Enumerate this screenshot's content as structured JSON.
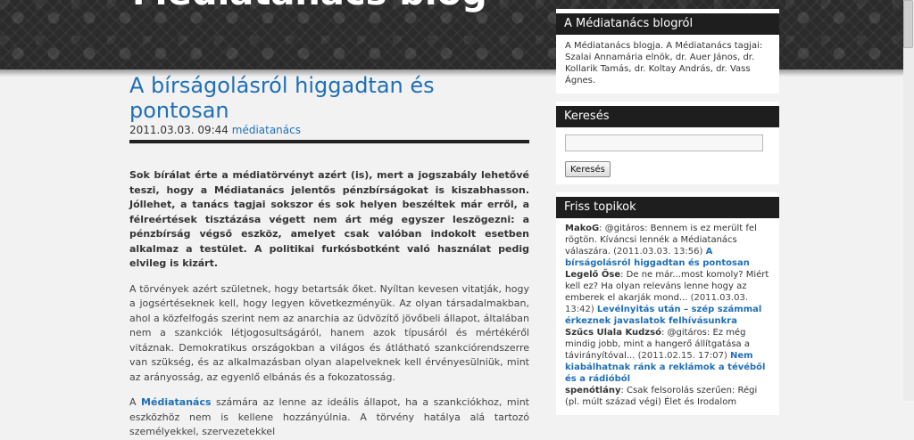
{
  "header": {
    "blog_title": "Médiatanács blog"
  },
  "post": {
    "title": "A bírságolásról higgadtan és pontosan",
    "date": "2011.03.03. 09:44",
    "author": "médiatanács",
    "lead": "Sok bírálat érte a médiatörvényt azért (is), mert a jogszabály lehetővé teszi, hogy a Médiatanács jelentős pénzbírságokat is kiszabhasson. Jóllehet, a tanács tagjai sokszor és sok helyen beszéltek már erről, a félreértések tisztázása végett nem árt még egyszer leszögezni: a pénzbírság végső eszköz, amelyet csak valóban indokolt esetben alkalmaz a testület. A politikai furkósbotként való használat pedig elvileg is kizárt.",
    "paragraph1": "A törvények azért születnek, hogy betartsák őket. Nyíltan kevesen vitatják, hogy a jogsértéseknek kell, hogy legyen következményük. Az olyan társadalmakban, ahol a közfelfogás szerint nem az anarchia az üdvözítő jövőbeli állapot, általában nem a szankciók létjogosultságáról, hanem azok típusáról és mértékéről vitáznak. Demokratikus országokban a világos és átlátható szankciórendszerre van szükség, és az alkalmazásban olyan alapelveknek kell érvényesülniük, mint az arányosság, az egyenlő elbánás és a fokozatosság.",
    "paragraph2_prefix": "A ",
    "paragraph2_link": "Médiatanács",
    "paragraph2_rest": " számára az lenne az ideális állapot, ha a szankciókhoz, mint eszközhöz nem is kellene hozzányúlnia. A törvény hatálya alá tartozó személyekkel, szervezetekkel"
  },
  "sidebar": {
    "about": {
      "title": "A Médiatanács blogról",
      "text": "A Médiatanács blogja. A Médiatanács tagjai: Szalai Annamária elnök, dr. Auer János, dr. Kollarik Tamás, dr. Koltay András, dr. Vass Ágnes."
    },
    "search": {
      "title": "Keresés",
      "input_value": "",
      "button_label": "Keresés"
    },
    "recent": {
      "title": "Friss topikok",
      "items": [
        {
          "author": "MakoG",
          "text": ": @gitáros: Bennem is ez merült fel rögtön. Kíváncsi lennék a Médiatanács válaszára.",
          "date": "(2011.03.03. 13:56)",
          "link": "A bírságolásról higgadtan és pontosan"
        },
        {
          "author": "Legelő Őse",
          "text": ": De ne már...most komoly? Miért kell ez? Ha olyan releváns lenne hogy az emberek el akarják mond...",
          "date": "(2011.03.03. 13:42)",
          "link": "Levélnyitás után – szép számmal érkeznek javaslatok felhívásunkra"
        },
        {
          "author": "Szűcs Ulala Kudzsó",
          "text": ": @gitáros: Ez még mindig jobb, mint a hangerő állítgatása a távirányítóval...",
          "date": "(2011.02.15. 17:07)",
          "link": "Nem kiabálhatnak ránk a reklámok a tévéből és a rádióból"
        },
        {
          "author": "spenótlány",
          "text": ": Csak felsorolás szerűen: Régi (pl. múlt század végi) Élet és Irodalom",
          "date": "",
          "link": ""
        }
      ]
    }
  }
}
